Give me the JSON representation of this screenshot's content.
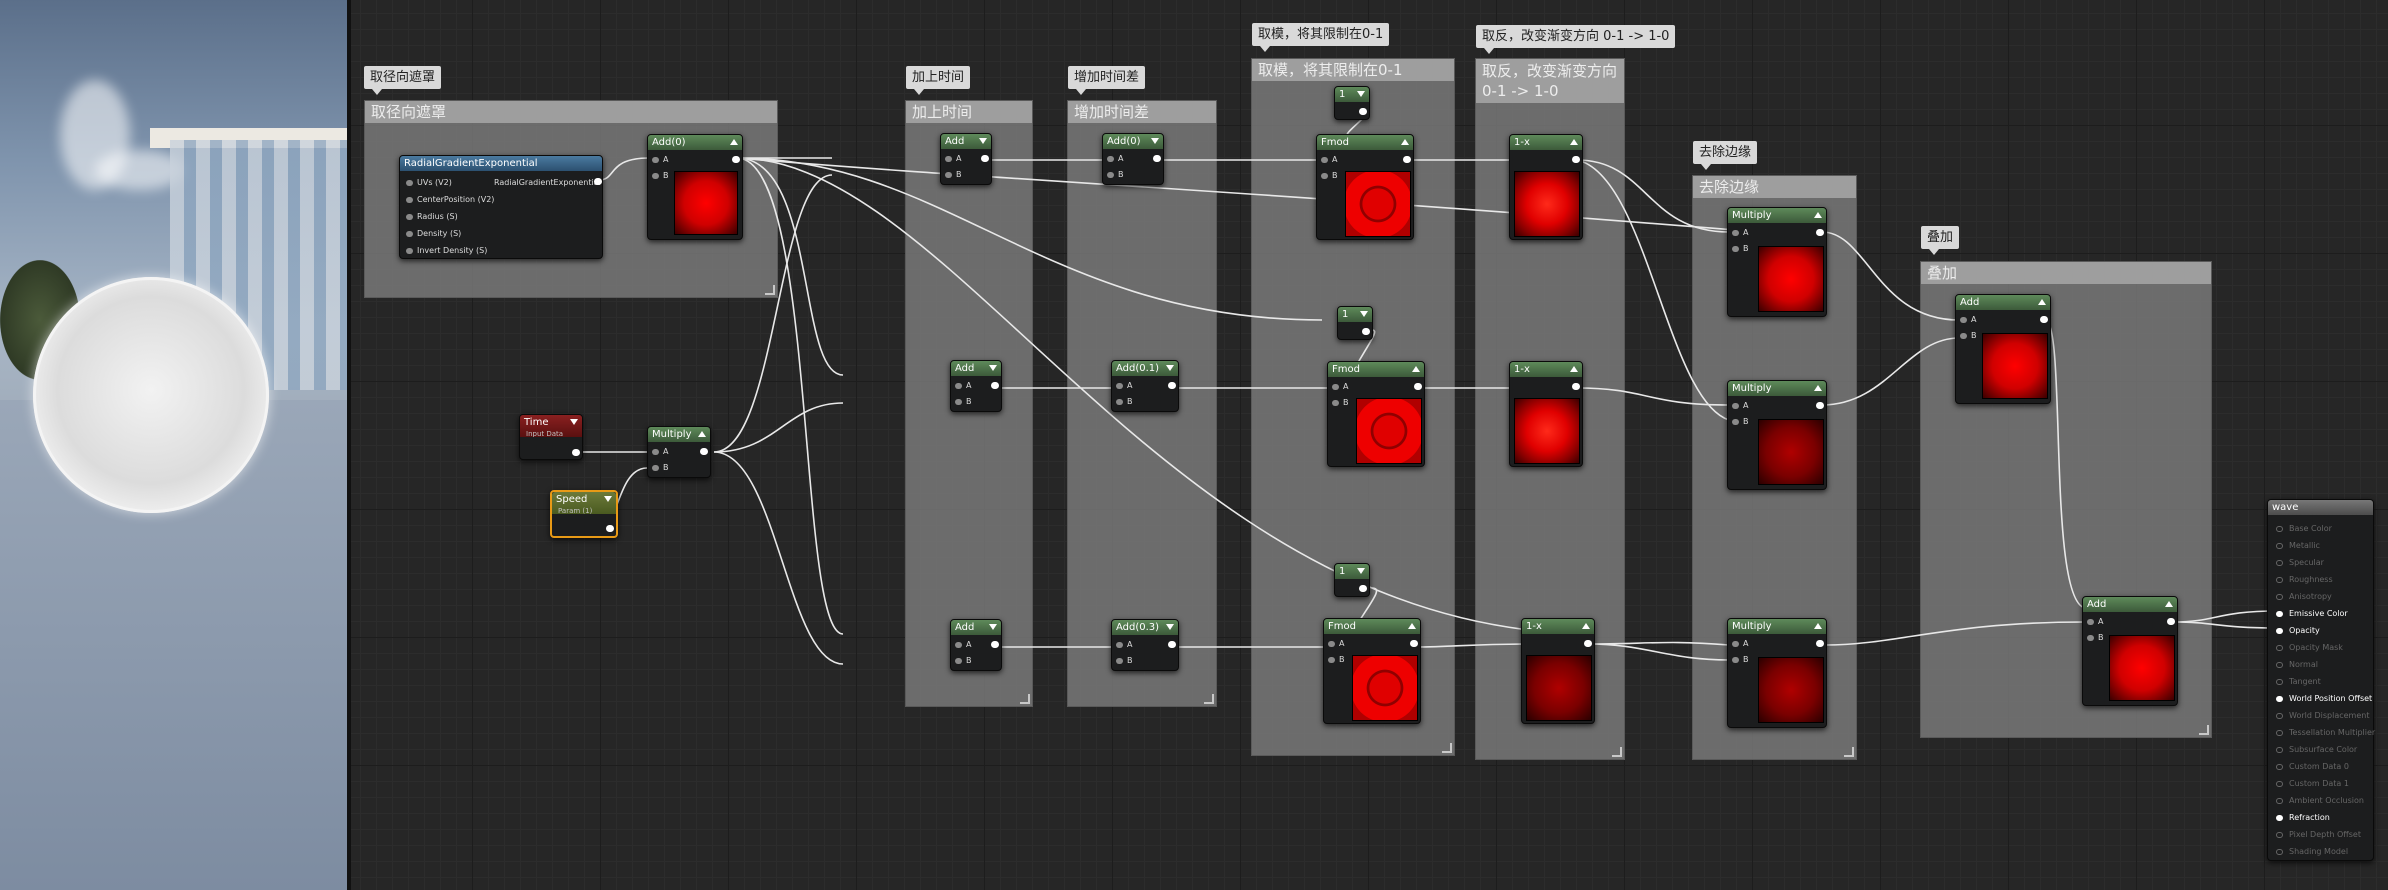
{
  "comments": {
    "radial_mask": "取径向遮罩",
    "add_time": "加上时间",
    "add_time_diff": "增加时间差",
    "fmod_clamp": "取模，将其限制在0-1",
    "invert": "取反，改变渐变方向 0-1 -> 1-0",
    "remove_edge": "去除边缘",
    "overlay": "叠加"
  },
  "nodes": {
    "radial": {
      "title": "RadialGradientExponential",
      "inputs": [
        "UVs (V2)",
        "CenterPosition (V2)",
        "Radius (S)",
        "Density (S)",
        "Invert Density (S)"
      ],
      "output": "RadialGradientExponential"
    },
    "add0_top": "Add(0)",
    "time": {
      "title": "Time",
      "subtitle": "Input Data"
    },
    "speed": {
      "title": "Speed",
      "subtitle": "Param (1)"
    },
    "multiply_time": "Multiply",
    "add_a": "Add",
    "add_b": "Add",
    "add_c": "Add",
    "add_0": "Add(0)",
    "add_01": "Add(0.1)",
    "add_03": "Add(0.3)",
    "const_1": "1",
    "fmod": "Fmod",
    "one_minus": "1-x",
    "multiply": "Multiply",
    "add": "Add",
    "pin_a": "A",
    "pin_b": "B"
  },
  "wave": {
    "title": "wave",
    "items": [
      {
        "label": "Base Color",
        "active": false
      },
      {
        "label": "Metallic",
        "active": false
      },
      {
        "label": "Specular",
        "active": false
      },
      {
        "label": "Roughness",
        "active": false
      },
      {
        "label": "Anisotropy",
        "active": false
      },
      {
        "label": "Emissive Color",
        "active": true
      },
      {
        "label": "Opacity",
        "active": true
      },
      {
        "label": "Opacity Mask",
        "active": false
      },
      {
        "label": "Normal",
        "active": false
      },
      {
        "label": "Tangent",
        "active": false
      },
      {
        "label": "World Position Offset",
        "active": true
      },
      {
        "label": "World Displacement",
        "active": false
      },
      {
        "label": "Tessellation Multiplier",
        "active": false
      },
      {
        "label": "Subsurface Color",
        "active": false
      },
      {
        "label": "Custom Data 0",
        "active": false
      },
      {
        "label": "Custom Data 1",
        "active": false
      },
      {
        "label": "Ambient Occlusion",
        "active": false
      },
      {
        "label": "Refraction",
        "active": true
      },
      {
        "label": "Pixel Depth Offset",
        "active": false
      },
      {
        "label": "Shading Model",
        "active": false
      }
    ]
  }
}
